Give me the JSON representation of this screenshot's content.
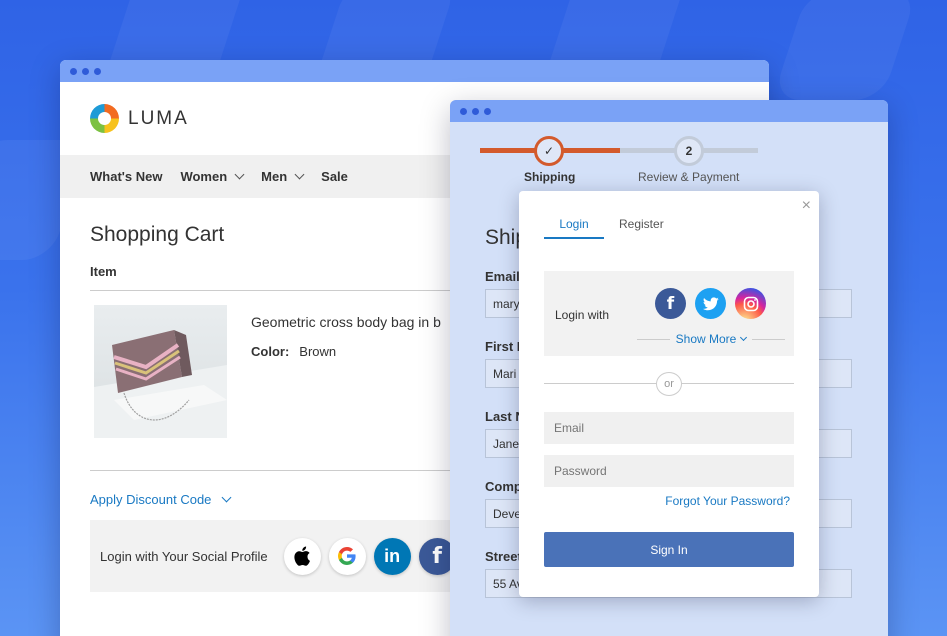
{
  "store": {
    "logo_text": "LUMA",
    "nav": [
      "What's New",
      "Women",
      "Men",
      "Sale"
    ]
  },
  "cart": {
    "title": "Shopping Cart",
    "item_header": "Item",
    "product_name": "Geometric cross body bag in b",
    "color_label": "Color:",
    "color_value": "Brown",
    "discount_link": "Apply Discount Code",
    "social_label": "Login with Your Social Profile",
    "social_icons": [
      "apple-icon",
      "google-icon",
      "linkedin-icon",
      "facebook-icon"
    ]
  },
  "checkout": {
    "steps": [
      {
        "label": "Shipping",
        "status": "done",
        "marker": "✓"
      },
      {
        "label": "Review & Payment",
        "status": "pending",
        "marker": "2"
      }
    ],
    "section_title": "Ship",
    "fields": [
      {
        "label": "Email",
        "value": "mary"
      },
      {
        "label": "First N",
        "value": "Mari"
      },
      {
        "label": "Last N",
        "value": "Jane"
      },
      {
        "label": "Comp",
        "value": "Deve"
      },
      {
        "label": "Street",
        "value": "55 Av"
      }
    ]
  },
  "modal": {
    "close": "×",
    "tabs": {
      "login": "Login",
      "register": "Register"
    },
    "login_with": "Login with",
    "social_icons": [
      "facebook-icon",
      "twitter-icon",
      "instagram-icon"
    ],
    "show_more": "Show More",
    "or": "or",
    "email_placeholder": "Email",
    "password_placeholder": "Password",
    "forgot": "Forgot Your Password?",
    "sign_in": "Sign In"
  },
  "colors": {
    "accent_blue": "#1979c3",
    "progress_done": "#d35a2c",
    "sign_in_button": "#4a72b8",
    "facebook": "#3b5998",
    "twitter": "#1da1f2",
    "linkedin": "#0077b5"
  }
}
